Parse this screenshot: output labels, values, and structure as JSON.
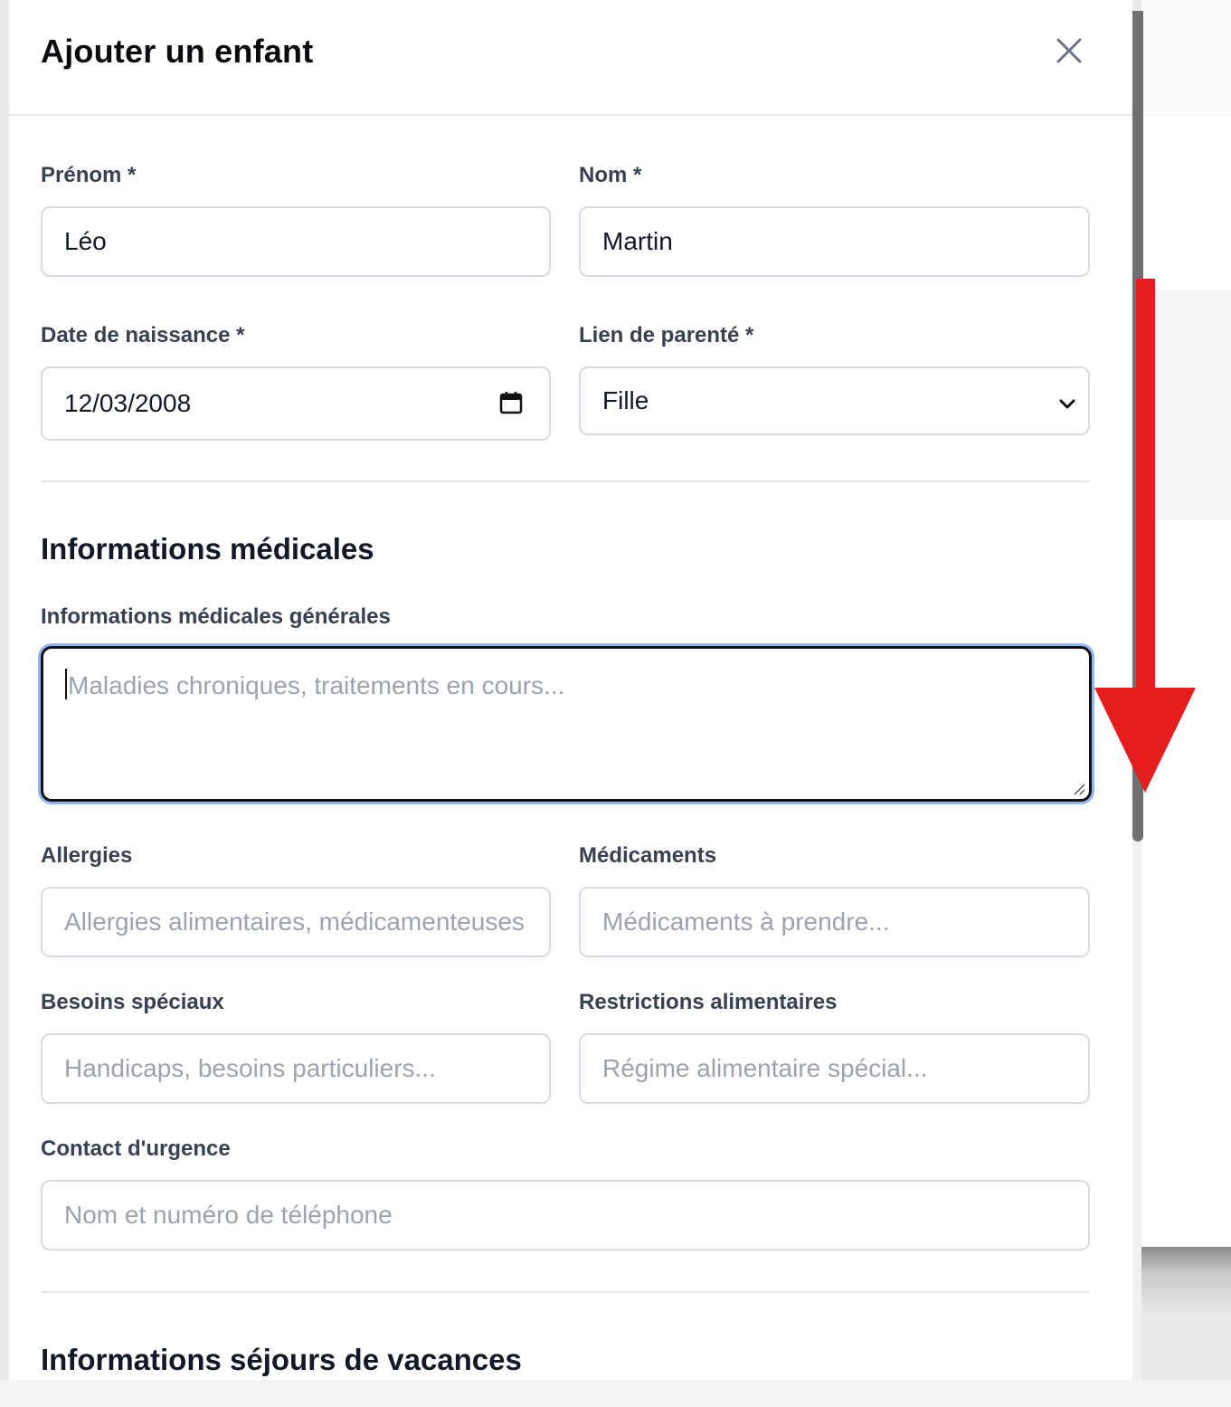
{
  "modal": {
    "title": "Ajouter un enfant",
    "close_icon": "close-icon"
  },
  "fields": {
    "prenom": {
      "label": "Prénom *",
      "value": "Léo"
    },
    "nom": {
      "label": "Nom *",
      "value": "Martin"
    },
    "date_naissance": {
      "label": "Date de naissance *",
      "value": "12/03/2008",
      "icon": "calendar-icon"
    },
    "lien_parente": {
      "label": "Lien de parenté *",
      "value": "Fille",
      "icon": "chevron-down-icon"
    }
  },
  "medical": {
    "section_title": "Informations médicales",
    "general": {
      "label": "Informations médicales générales",
      "placeholder": "Maladies chroniques, traitements en cours..."
    },
    "allergies": {
      "label": "Allergies",
      "placeholder": "Allergies alimentaires, médicamenteuses"
    },
    "medicaments": {
      "label": "Médicaments",
      "placeholder": "Médicaments à prendre..."
    },
    "besoins": {
      "label": "Besoins spéciaux",
      "placeholder": "Handicaps, besoins particuliers..."
    },
    "restrictions": {
      "label": "Restrictions alimentaires",
      "placeholder": "Régime alimentaire spécial..."
    },
    "contact": {
      "label": "Contact d'urgence",
      "placeholder": "Nom et numéro de téléphone"
    }
  },
  "vacances": {
    "section_title": "Informations séjours de vacances"
  },
  "colors": {
    "annotation_arrow": "#e41e1e",
    "focus_ring": "#93b4f5",
    "scroll_thumb": "#707070"
  }
}
